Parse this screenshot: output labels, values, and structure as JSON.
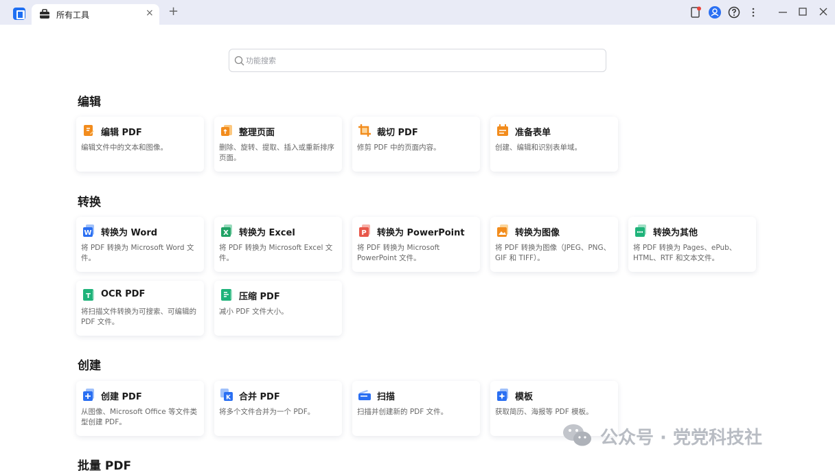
{
  "window": {
    "tab_title": "所有工具",
    "tab_close": "×",
    "tab_add": "+"
  },
  "search": {
    "placeholder": "功能搜索"
  },
  "sections": [
    {
      "title": "编辑",
      "cards": [
        {
          "icon": "edit-pdf-icon",
          "color": "#f28c1d",
          "title": "编辑 PDF",
          "desc": "编辑文件中的文本和图像。"
        },
        {
          "icon": "organize-pages-icon",
          "color": "#f28c1d",
          "title": "整理页面",
          "desc": "删除、旋转、提取、插入或重新排序页面。"
        },
        {
          "icon": "crop-pdf-icon",
          "color": "#f28c1d",
          "title": "裁切 PDF",
          "desc": "修剪 PDF 中的页面内容。"
        },
        {
          "icon": "prepare-form-icon",
          "color": "#f28c1d",
          "title": "准备表单",
          "desc": "创建、编辑和识别表单域。"
        }
      ]
    },
    {
      "title": "转换",
      "cards": [
        {
          "icon": "word-icon",
          "color": "#2a6ff2",
          "letter": "W",
          "title": "转换为 Word",
          "desc": "将 PDF 转换为 Microsoft Word 文件。"
        },
        {
          "icon": "excel-icon",
          "color": "#21a366",
          "letter": "X",
          "title": "转换为 Excel",
          "desc": "将 PDF 转换为 Microsoft Excel 文件。"
        },
        {
          "icon": "powerpoint-icon",
          "color": "#e8574a",
          "letter": "P",
          "title": "转换为 PowerPoint",
          "desc": "将 PDF 转换为 Microsoft PowerPoint 文件。"
        },
        {
          "icon": "image-icon",
          "color": "#f28c1d",
          "title": "转换为图像",
          "desc": "将 PDF 转换为图像（JPEG、PNG、GIF 和 TIFF）。"
        },
        {
          "icon": "other-formats-icon",
          "color": "#1fb37a",
          "title": "转换为其他",
          "desc": "将 PDF 转换为 Pages、ePub、HTML、RTF 和文本文件。"
        },
        {
          "icon": "ocr-icon",
          "color": "#1fb37a",
          "letter": "T",
          "title": "OCR PDF",
          "desc": "将扫描文件转换为可搜索、可编辑的 PDF 文件。"
        },
        {
          "icon": "compress-icon",
          "color": "#1fb37a",
          "title": "压缩 PDF",
          "desc": "减小 PDF 文件大小。"
        }
      ]
    },
    {
      "title": "创建",
      "cards": [
        {
          "icon": "create-pdf-icon",
          "color": "#2a6ff2",
          "title": "创建 PDF",
          "desc": "从图像、Microsoft Office 等文件类型创建 PDF。"
        },
        {
          "icon": "merge-pdf-icon",
          "color": "#2a6ff2",
          "letter": "K",
          "title": "合并 PDF",
          "desc": "将多个文件合并为一个 PDF。"
        },
        {
          "icon": "scan-icon",
          "color": "#2a6ff2",
          "title": "扫描",
          "desc": "扫描并创建新的 PDF 文件。"
        },
        {
          "icon": "template-icon",
          "color": "#2a6ff2",
          "title": "模板",
          "desc": "获取简历、海报等 PDF 模板。"
        }
      ]
    },
    {
      "title": "批量 PDF",
      "cards": []
    }
  ],
  "watermark": {
    "text": "公众号 · 党党科技社"
  }
}
